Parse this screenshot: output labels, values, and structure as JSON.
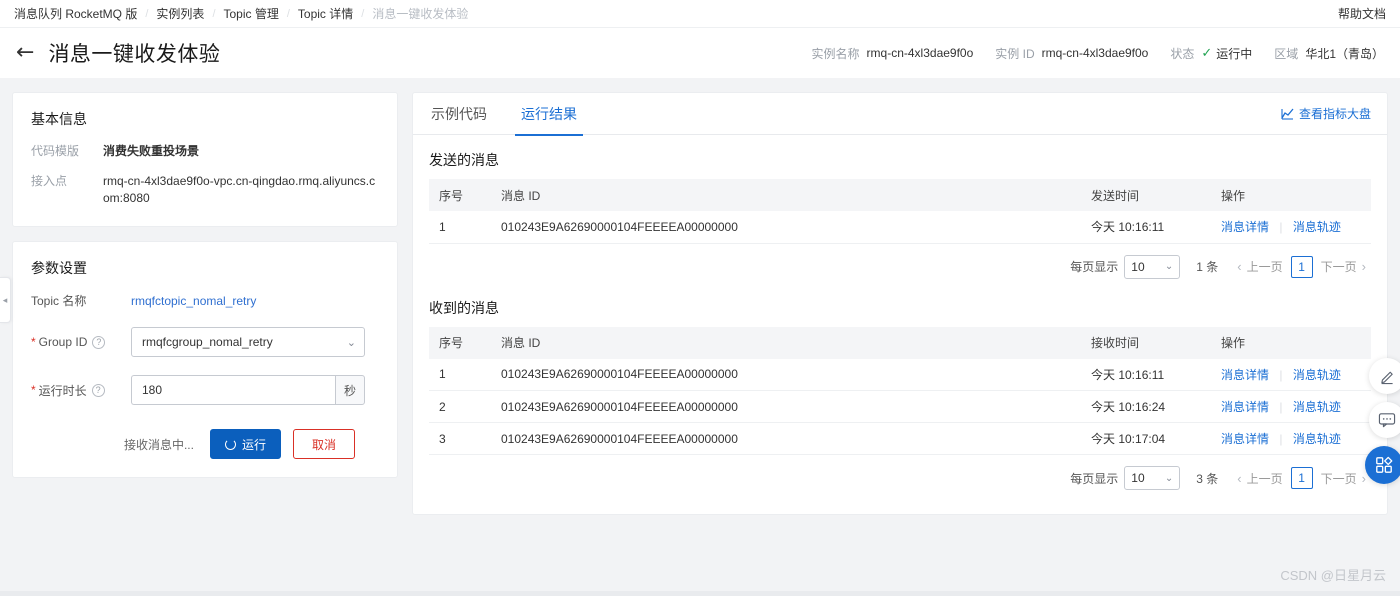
{
  "breadcrumb": {
    "items": [
      {
        "label": "消息队列 RocketMQ 版",
        "muted": false
      },
      {
        "label": "实例列表",
        "muted": false
      },
      {
        "label": "Topic 管理",
        "muted": false
      },
      {
        "label": "Topic 详情",
        "muted": false
      },
      {
        "label": "消息一键收发体验",
        "muted": true
      }
    ],
    "separator": "/",
    "help_doc": "帮助文档"
  },
  "header": {
    "back_icon": "←",
    "title": "消息一键收发体验",
    "meta": [
      {
        "label": "实例名称",
        "value": "rmq-cn-4xl3dae9f0o"
      },
      {
        "label": "实例 ID",
        "value": "rmq-cn-4xl3dae9f0o"
      },
      {
        "label": "状态",
        "value": "运行中",
        "tick": "✓"
      },
      {
        "label": "区域",
        "value": "华北1（青岛）"
      }
    ]
  },
  "basic_info": {
    "title": "基本信息",
    "rows": [
      {
        "label": "代码模版",
        "value": "消费失败重投场景",
        "bold": true
      },
      {
        "label": "接入点",
        "value": "rmq-cn-4xl3dae9f0o-vpc.cn-qingdao.rmq.aliyuncs.com:8080",
        "bold": false
      }
    ]
  },
  "params": {
    "title": "参数设置",
    "topic_label": "Topic 名称",
    "topic_value": "rmqfctopic_nomal_retry",
    "group_label": "Group ID",
    "group_value": "rmqfcgroup_nomal_retry",
    "duration_label": "运行时长",
    "duration_value": "180",
    "duration_unit": "秒",
    "required_mark": "*",
    "help_mark": "?",
    "caret": "⌄",
    "status_text": "接收消息中...",
    "run_label": "运行",
    "cancel_label": "取消"
  },
  "right_panel": {
    "tabs": [
      {
        "label": "示例代码",
        "active": false
      },
      {
        "label": "运行结果",
        "active": true
      }
    ],
    "metrics_link": "查看指标大盘",
    "metrics_icon": "chart-line-icon"
  },
  "sent": {
    "section_title": "发送的消息",
    "columns": [
      "序号",
      "消息 ID",
      "发送时间",
      "操作"
    ],
    "rows": [
      {
        "idx": "1",
        "msg_id": "010243E9A62690000104FEEEEA00000000",
        "time": "今天 10:16:11",
        "op1": "消息详情",
        "op2": "消息轨迹"
      }
    ],
    "pager": {
      "label": "每页显示",
      "page_size": "10",
      "total": "1 条",
      "prev": "上一页",
      "current": "1",
      "next": "下一页",
      "prev_arrow": "‹",
      "next_arrow": "›",
      "caret": "⌄"
    }
  },
  "received": {
    "section_title": "收到的消息",
    "columns": [
      "序号",
      "消息 ID",
      "接收时间",
      "操作"
    ],
    "rows": [
      {
        "idx": "1",
        "msg_id": "010243E9A62690000104FEEEEA00000000",
        "time": "今天 10:16:11",
        "op1": "消息详情",
        "op2": "消息轨迹"
      },
      {
        "idx": "2",
        "msg_id": "010243E9A62690000104FEEEEA00000000",
        "time": "今天 10:16:24",
        "op1": "消息详情",
        "op2": "消息轨迹"
      },
      {
        "idx": "3",
        "msg_id": "010243E9A62690000104FEEEEA00000000",
        "time": "今天 10:17:04",
        "op1": "消息详情",
        "op2": "消息轨迹"
      }
    ],
    "pager": {
      "label": "每页显示",
      "page_size": "10",
      "total": "3 条",
      "prev": "上一页",
      "current": "1",
      "next": "下一页",
      "prev_arrow": "‹",
      "next_arrow": "›",
      "caret": "⌄"
    }
  },
  "floating": {
    "buttons": [
      {
        "name": "edit-pencil-icon"
      },
      {
        "name": "feedback-chat-icon"
      },
      {
        "name": "apps-grid-icon"
      }
    ]
  },
  "side_handle": {
    "icon": "◂"
  },
  "watermark": "CSDN @日星月云",
  "colors": {
    "accent": "#1b6fd4",
    "primary_button": "#0b5fbd",
    "danger": "#d93026",
    "success": "#22a352",
    "page_bg": "#f2f3f5"
  }
}
